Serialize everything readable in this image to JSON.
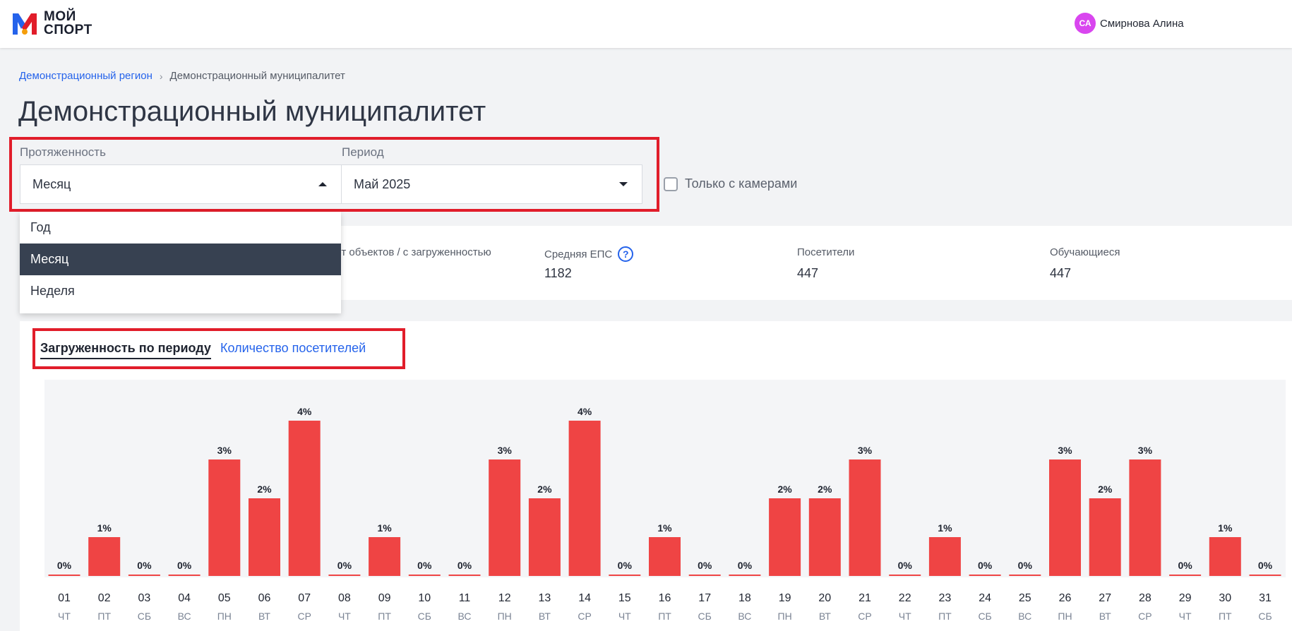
{
  "header": {
    "logo_line1": "МОЙ",
    "logo_line2": "СПОРТ",
    "user_initials": "СА",
    "user_name": "Смирнова Алина"
  },
  "breadcrumb": {
    "region": "Демонстрационный регион",
    "current": "Демонстрационный муниципалитет"
  },
  "page_title": "Демонстрационный муниципалитет",
  "filters": {
    "length_label": "Протяженность",
    "length_value": "Месяц",
    "period_label": "Период",
    "period_value": "Май 2025",
    "cameras_label": "Только с камерами",
    "cameras_checked": false
  },
  "dropdown": {
    "options": [
      "Год",
      "Месяц",
      "Неделя"
    ],
    "selected": "Месяц"
  },
  "stats": {
    "objects_label": "орт объектов / с загруженностью",
    "eps_label": "Средняя ЕПС",
    "eps_value": "1182",
    "visitors_label": "Посетители",
    "visitors_value": "447",
    "students_label": "Обучающиеся",
    "students_value": "447"
  },
  "tabs": {
    "load": "Загруженность по периоду",
    "visitors": "Количество посетителей"
  },
  "colors": {
    "bar": "#ef4444",
    "accent_blue": "#2563eb",
    "highlight_red": "#e11d2a"
  },
  "chart_data": {
    "type": "bar",
    "categories": [
      "01",
      "02",
      "03",
      "04",
      "05",
      "06",
      "07",
      "08",
      "09",
      "10",
      "11",
      "12",
      "13",
      "14",
      "15",
      "16",
      "17",
      "18",
      "19",
      "20",
      "21",
      "22",
      "23",
      "24",
      "25",
      "26",
      "27",
      "28",
      "29",
      "30",
      "31"
    ],
    "weekdays": [
      "ЧТ",
      "ПТ",
      "СБ",
      "ВС",
      "ПН",
      "ВТ",
      "СР",
      "ЧТ",
      "ПТ",
      "СБ",
      "ВС",
      "ПН",
      "ВТ",
      "СР",
      "ЧТ",
      "ПТ",
      "СБ",
      "ВС",
      "ПН",
      "ВТ",
      "СР",
      "ЧТ",
      "ПТ",
      "СБ",
      "ВС",
      "ПН",
      "ВТ",
      "СР",
      "ЧТ",
      "ПТ",
      "СБ"
    ],
    "values": [
      0,
      1,
      0,
      0,
      3,
      2,
      4,
      0,
      1,
      0,
      0,
      3,
      2,
      4,
      0,
      1,
      0,
      0,
      2,
      2,
      3,
      0,
      1,
      0,
      0,
      3,
      2,
      3,
      0,
      1,
      0
    ],
    "labels": [
      "0%",
      "1%",
      "0%",
      "0%",
      "3%",
      "2%",
      "4%",
      "0%",
      "1%",
      "0%",
      "0%",
      "3%",
      "2%",
      "4%",
      "0%",
      "1%",
      "0%",
      "0%",
      "2%",
      "2%",
      "3%",
      "0%",
      "1%",
      "0%",
      "0%",
      "3%",
      "2%",
      "3%",
      "0%",
      "1%",
      "0%"
    ],
    "ylim": [
      0,
      4
    ]
  }
}
